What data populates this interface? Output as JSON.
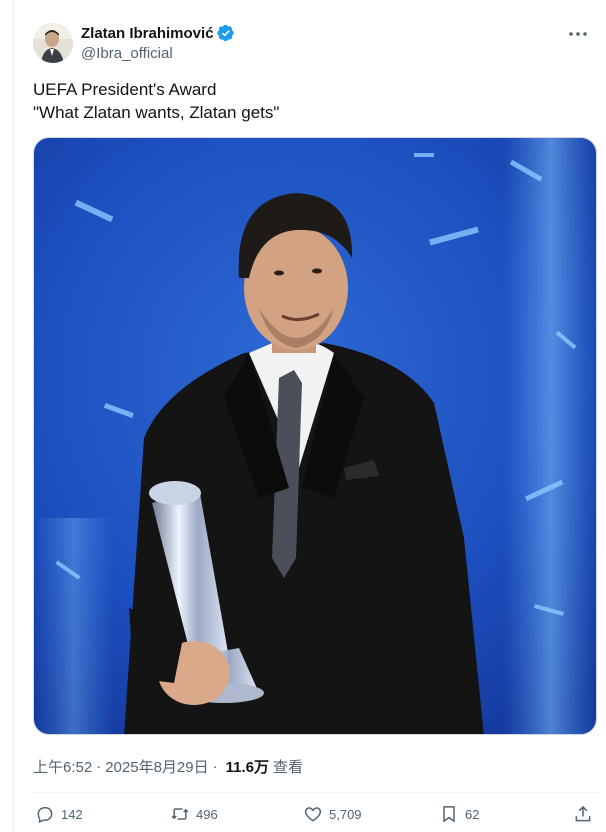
{
  "author": {
    "display_name": "Zlatan Ibrahimović",
    "handle": "@Ibra_official",
    "verified": true
  },
  "tweet": {
    "lines": [
      "UEFA President's Award",
      "\"What Zlatan wants, Zlatan gets\""
    ]
  },
  "media": {
    "description_icon": "photo",
    "bg_color": "#1f4fb8"
  },
  "meta": {
    "time": "上午6:52",
    "separator": "·",
    "date": "2025年8月29日",
    "views_count": "11.6万",
    "views_label": "查看"
  },
  "actions": {
    "replies": "142",
    "retweets": "496",
    "likes": "5,709",
    "bookmarks": "62"
  },
  "icons": {
    "reply": "reply-icon",
    "retweet": "retweet-icon",
    "like": "heart-icon",
    "bookmark": "bookmark-icon",
    "share": "share-icon",
    "more": "more-icon",
    "verified": "verified-badge-icon"
  },
  "colors": {
    "text_primary": "#0f1419",
    "text_secondary": "#536471",
    "verified_blue": "#1d9bf0",
    "border": "#cfd9de"
  }
}
